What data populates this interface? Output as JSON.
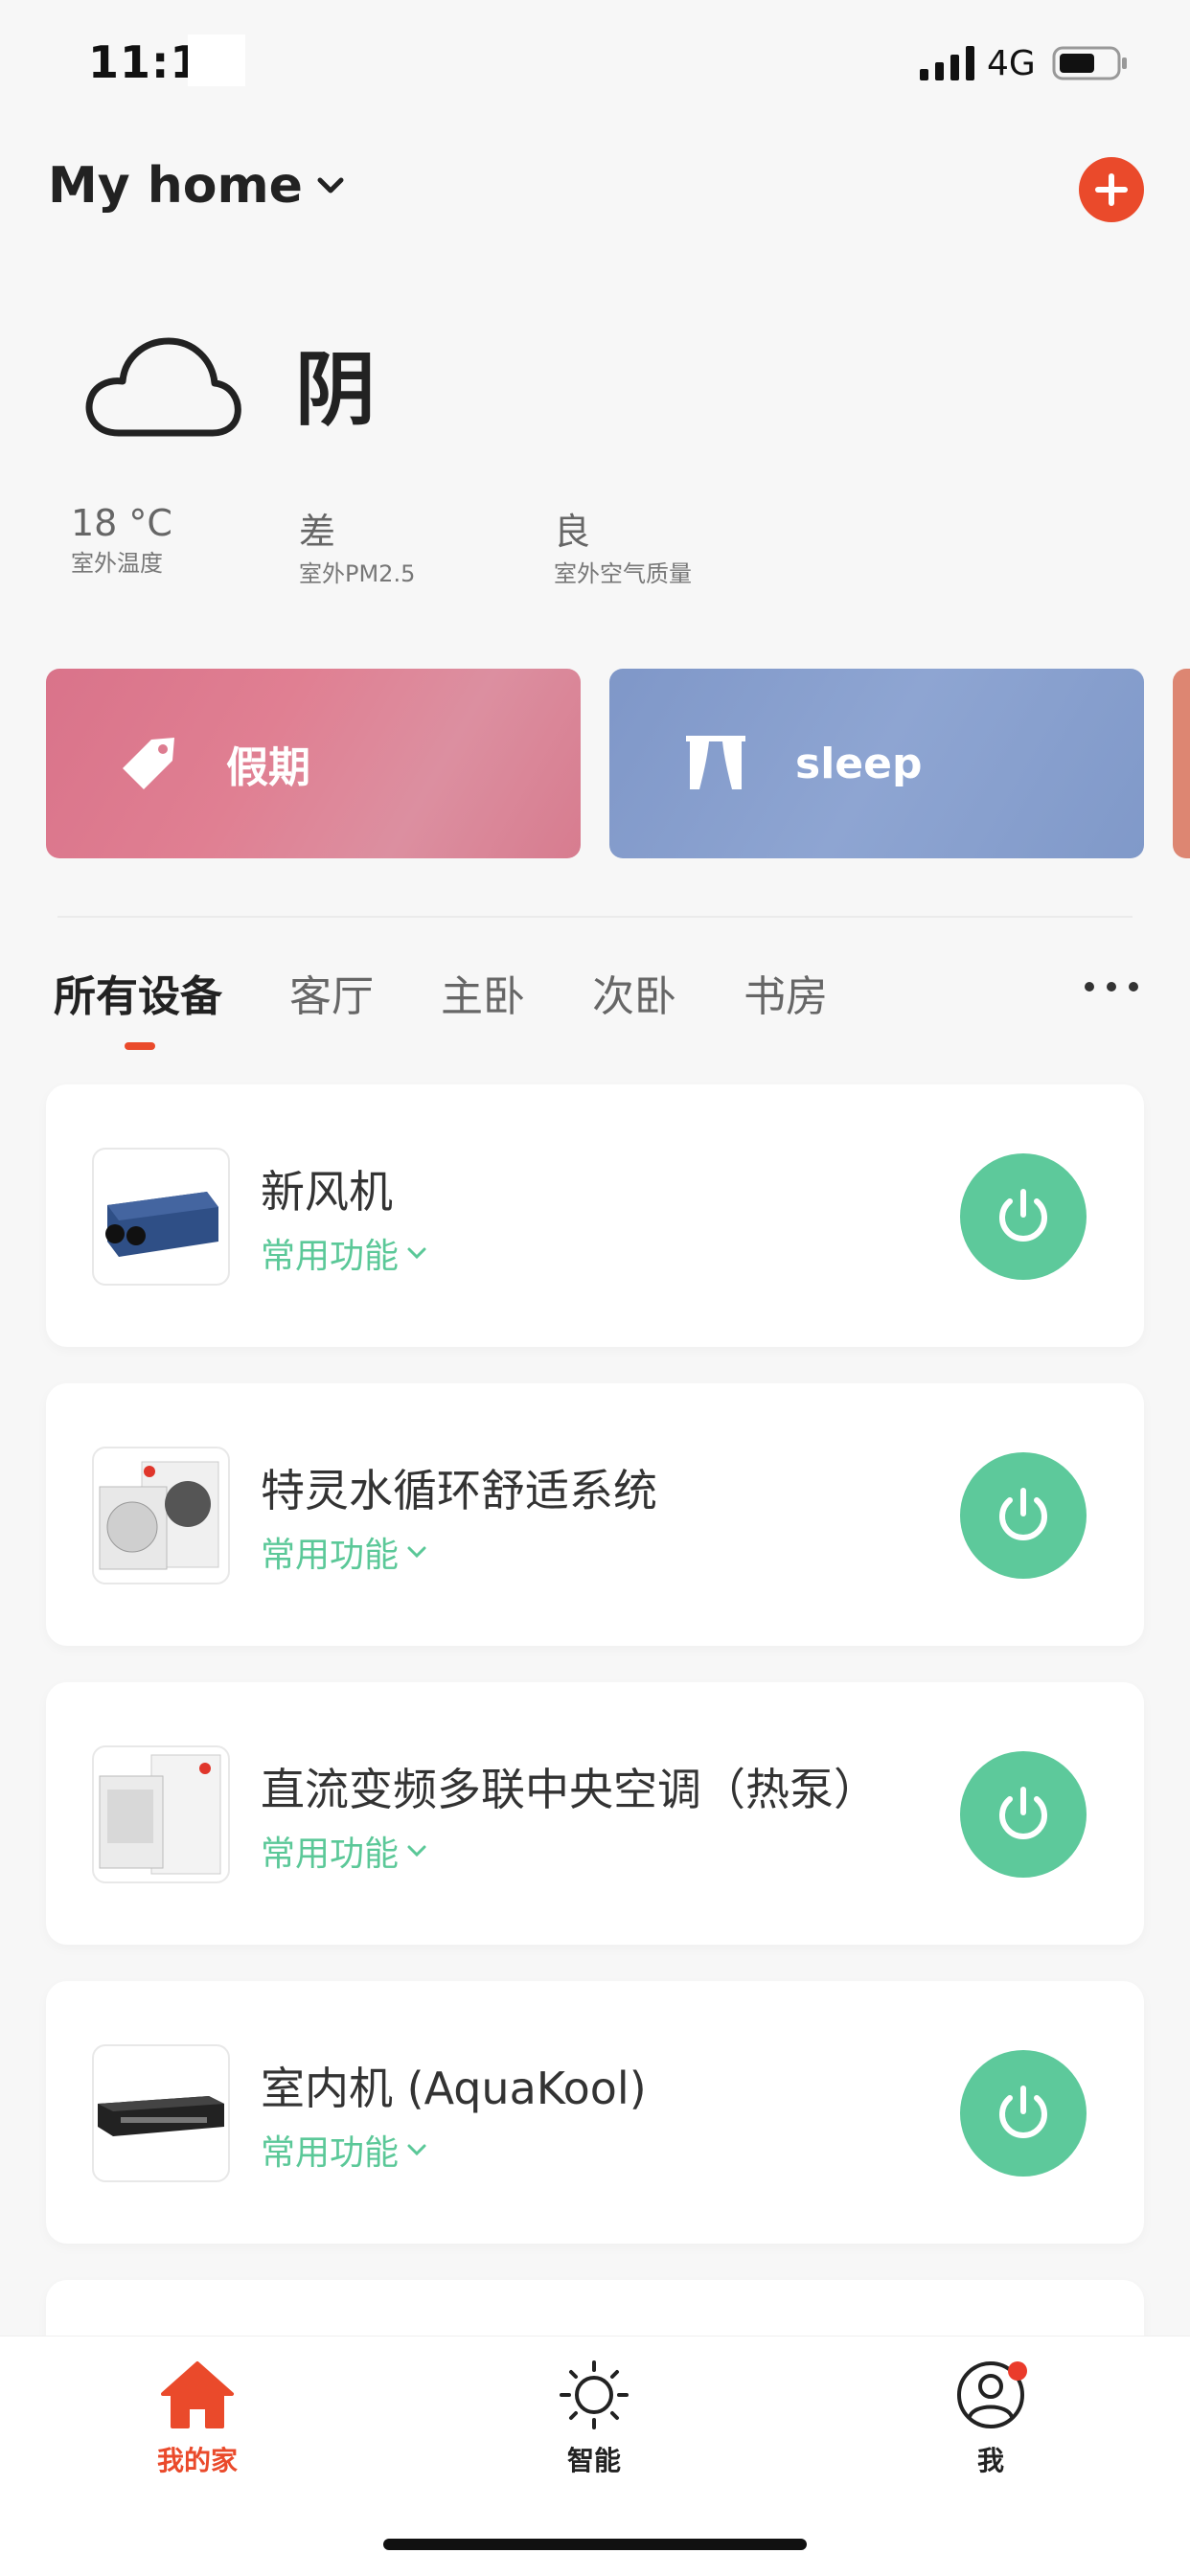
{
  "status_bar": {
    "time": "11:14",
    "network": "4G"
  },
  "header": {
    "title": "My home"
  },
  "weather": {
    "condition": "阴",
    "stats": [
      {
        "value": "18 °C",
        "label": "室外温度"
      },
      {
        "value": "差",
        "label": "室外PM2.5"
      },
      {
        "value": "良",
        "label": "室外空气质量"
      }
    ]
  },
  "scenes": [
    {
      "label": "假期",
      "icon": "tag-icon"
    },
    {
      "label": "sleep",
      "icon": "curtain-icon"
    }
  ],
  "tabs": [
    "所有设备",
    "客厅",
    "主卧",
    "次卧",
    "书房"
  ],
  "devices": [
    {
      "name": "新风机",
      "function": "常用功能"
    },
    {
      "name": "特灵水循环舒适系统",
      "function": "常用功能"
    },
    {
      "name": "直流变频多联中央空调（热泵）",
      "function": "常用功能"
    },
    {
      "name": "室内机 (AquaKool)",
      "function": "常用功能"
    }
  ],
  "bottom_nav": [
    {
      "label": "我的家",
      "icon": "home-icon",
      "active": true,
      "color": "#ea4a2b"
    },
    {
      "label": "智能",
      "icon": "sun-icon",
      "active": false,
      "color": "#222222"
    },
    {
      "label": "我",
      "icon": "user-icon",
      "active": false,
      "color": "#222222"
    }
  ],
  "colors": {
    "accent": "#ea4a2b",
    "power": "#5dc99b",
    "function_text": "#5bc898"
  }
}
